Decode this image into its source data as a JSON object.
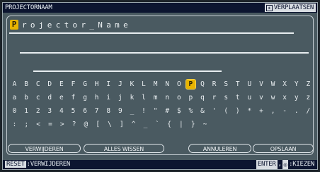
{
  "title": "PROJECTORNAAM",
  "move_label": "VERPLAATSEN",
  "name_text": "Projector_Name",
  "name_cursor_char": "P",
  "name_rest": "rojector_Name",
  "keyboard_rows": [
    [
      "A",
      "B",
      "C",
      "D",
      "E",
      "F",
      "G",
      "H",
      "I",
      "J",
      "K",
      "L",
      "M",
      "N",
      "O",
      "P",
      "Q",
      "R",
      "S",
      "T",
      "U",
      "V",
      "W",
      "X",
      "Y",
      "Z"
    ],
    [
      "a",
      "b",
      "c",
      "d",
      "e",
      "f",
      "g",
      "h",
      "i",
      "j",
      "k",
      "l",
      "m",
      "n",
      "o",
      "p",
      "q",
      "r",
      "s",
      "t",
      "u",
      "v",
      "w",
      "x",
      "y",
      "z"
    ],
    [
      "0",
      "1",
      "2",
      "3",
      "4",
      "5",
      "6",
      "7",
      "8",
      "9",
      "_",
      "!",
      "\"",
      "#",
      "$",
      "%",
      "&",
      "'",
      "(",
      ")",
      "*",
      "+",
      ",",
      "-",
      ".",
      "/"
    ],
    [
      ":",
      ";",
      "<",
      "=",
      ">",
      "?",
      "@",
      "[",
      "\\",
      "]",
      "^",
      "_",
      "`",
      "{",
      "|",
      "}",
      "~"
    ]
  ],
  "selected_key": "P",
  "buttons": {
    "delete": "VERWIJDEREN",
    "clear_all": "ALLES WISSEN",
    "cancel": "ANNULEREN",
    "save": "OPSLAAN"
  },
  "status": {
    "reset": "RESET",
    "reset_action": ":VERWIJDEREN",
    "enter": "ENTER",
    "enter_sep": ",",
    "enter_icon": "◎",
    "enter_action": ":KIEZEN"
  }
}
